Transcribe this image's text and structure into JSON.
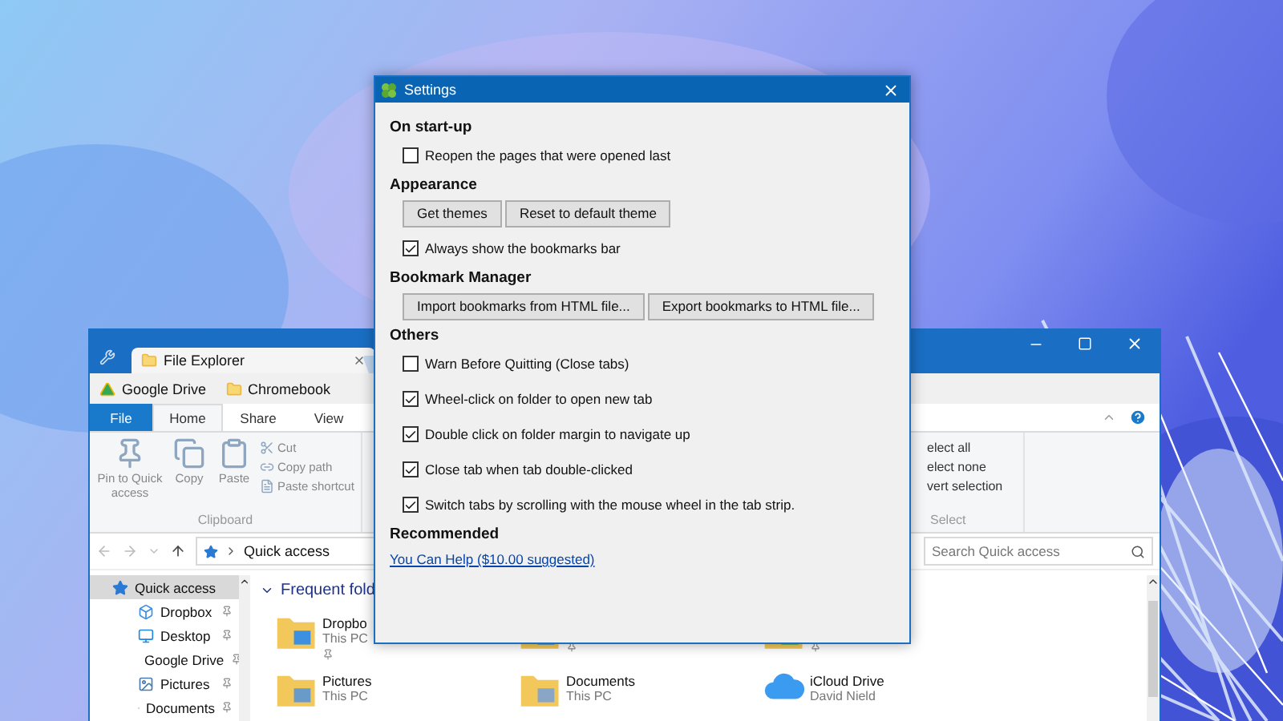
{
  "explorer": {
    "tabs": [
      {
        "label": "File Explorer",
        "selected": true
      }
    ],
    "bookmarks": [
      {
        "label": "Google Drive",
        "kind": "drive"
      },
      {
        "label": "Chromebook",
        "kind": "folder"
      }
    ],
    "ribbon_tabs": [
      {
        "label": "File",
        "kind": "file",
        "selected": false
      },
      {
        "label": "Home",
        "kind": "tab",
        "selected": true
      },
      {
        "label": "Share",
        "kind": "tab",
        "selected": false
      },
      {
        "label": "View",
        "kind": "tab",
        "selected": false
      }
    ],
    "clipboard": {
      "label": "Clipboard",
      "large": [
        {
          "label": "Pin to Quick access",
          "kind": "pin"
        },
        {
          "label": "Copy",
          "kind": "copy"
        },
        {
          "label": "Paste",
          "kind": "paste"
        }
      ],
      "small": [
        {
          "label": "Cut",
          "kind": "cut"
        },
        {
          "label": "Copy path",
          "kind": "path"
        },
        {
          "label": "Paste shortcut",
          "kind": "shortcut"
        }
      ]
    },
    "select_group": {
      "label": "Select",
      "items": [
        "elect all",
        "elect none",
        "vert selection"
      ]
    },
    "address": "Quick access",
    "search": {
      "placeholder": "Search Quick access"
    },
    "nav": [
      {
        "label": "Quick access",
        "kind": "star",
        "selected": true,
        "pinned": false
      },
      {
        "label": "Dropbox",
        "kind": "dropbox",
        "selected": false,
        "pinned": true
      },
      {
        "label": "Desktop",
        "kind": "desktop",
        "selected": false,
        "pinned": true
      },
      {
        "label": "Google Drive",
        "kind": "drive",
        "selected": false,
        "pinned": true
      },
      {
        "label": "Pictures",
        "kind": "pictures",
        "selected": false,
        "pinned": true
      },
      {
        "label": "Documents",
        "kind": "documents",
        "selected": false,
        "pinned": true
      }
    ],
    "section_title": "Frequent fold",
    "folders": [
      {
        "kind": "dropbox",
        "name": "Dropbo",
        "location": "This PC",
        "pinned": true
      },
      {
        "kind": "desktop",
        "pinned": true
      },
      {
        "kind": "drive",
        "pinned": true
      },
      {
        "kind": "pictures",
        "name": "Pictures",
        "location": "This PC",
        "pinned": false
      },
      {
        "kind": "documents",
        "name": "Documents",
        "location": "This PC",
        "pinned": false
      },
      {
        "kind": "icloud",
        "name": "iCloud Drive",
        "location": "David Nield",
        "pinned": false
      }
    ]
  },
  "settings": {
    "title": "Settings",
    "sections": [
      {
        "heading": "On start-up",
        "items": [
          {
            "kind": "checkbox",
            "label": "Reopen the pages that were opened last",
            "checked": false
          }
        ]
      },
      {
        "heading": "Appearance",
        "items": [
          {
            "kind": "buttons",
            "buttons": [
              "Get themes",
              "Reset to default theme"
            ]
          },
          {
            "kind": "checkbox",
            "label": "Always show the bookmarks bar",
            "checked": true
          }
        ]
      },
      {
        "heading": "Bookmark Manager",
        "items": [
          {
            "kind": "buttons",
            "buttons": [
              "Import bookmarks from HTML file...",
              "Export bookmarks to HTML file..."
            ]
          }
        ]
      },
      {
        "heading": "Others",
        "items": [
          {
            "kind": "checkbox",
            "label": "Warn Before Quitting (Close tabs)",
            "checked": false
          },
          {
            "kind": "checkbox",
            "label": "Wheel-click on folder to open new tab",
            "checked": true
          },
          {
            "kind": "checkbox",
            "label": "Double click on folder margin to navigate up",
            "checked": true
          },
          {
            "kind": "checkbox",
            "label": "Close tab when tab double-clicked",
            "checked": true
          },
          {
            "kind": "checkbox",
            "label": "Switch tabs by scrolling with the mouse wheel in the tab strip.",
            "checked": true
          }
        ]
      },
      {
        "heading": "Recommended",
        "items": [
          {
            "kind": "link",
            "label": "You Can Help ($10.00 suggested)"
          }
        ]
      }
    ]
  }
}
